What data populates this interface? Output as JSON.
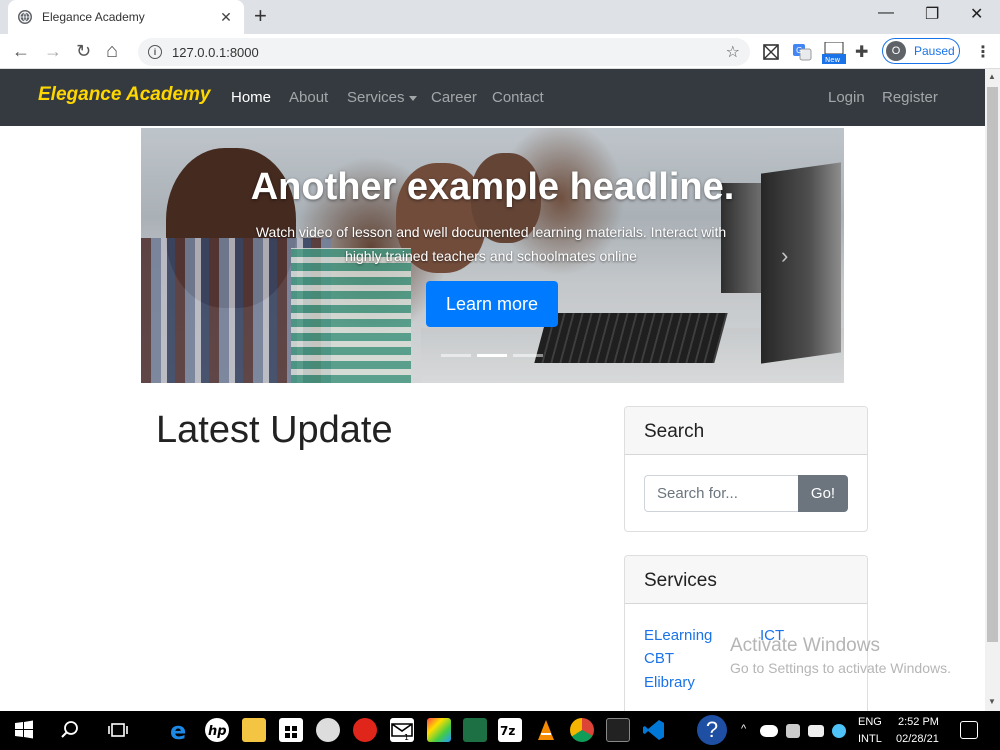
{
  "browser": {
    "tab_title": "Elegance Academy",
    "tab_close": "✕",
    "new_tab": "+",
    "window_minimize": "—",
    "window_restore": "❐",
    "window_close": "✕",
    "back": "←",
    "forward": "→",
    "reload": "↻",
    "home": "⌂",
    "url": "127.0.0.1:8000",
    "bookmark": "☆",
    "extension_new_badge": "New",
    "profile_initial": "O",
    "profile_status": "Paused",
    "menu": "⋮"
  },
  "site": {
    "brand": "Elegance Academy",
    "nav": {
      "home": "Home",
      "about": "About",
      "services": "Services",
      "career": "Career",
      "contact": "Contact",
      "login": "Login",
      "register": "Register"
    },
    "carousel": {
      "headline": "Another example headline.",
      "text": "Watch video of lesson and well documented learning materials. Interact with highly trained teachers and schoolmates online",
      "button": "Learn more",
      "next": "›"
    },
    "main": {
      "heading": "Latest Update"
    },
    "search": {
      "header": "Search",
      "placeholder": "Search for...",
      "button": "Go!"
    },
    "services": {
      "header": "Services",
      "links": [
        "ELearning",
        "ICT",
        "CBT",
        "Elibrary"
      ]
    }
  },
  "os": {
    "watermark_title": "Activate Windows",
    "watermark_sub": "Go to Settings to activate Windows.",
    "lang": "ENG",
    "layout": "INTL",
    "time": "2:52 PM",
    "date": "02/28/21",
    "mail_badge": "1"
  }
}
